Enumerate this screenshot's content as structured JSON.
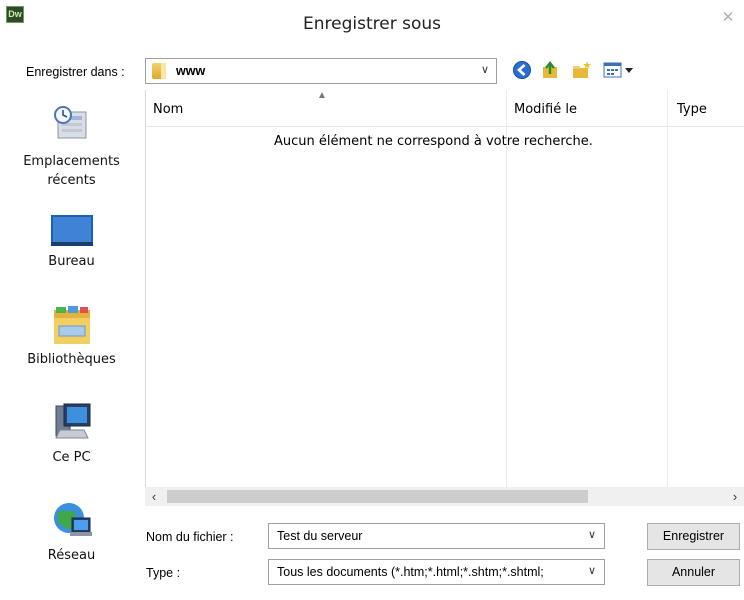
{
  "window": {
    "title": "Enregistrer sous",
    "app_icon": "Dw",
    "close_glyph": "✕"
  },
  "location": {
    "label": "Enregistrer dans :",
    "value": "www",
    "toolbar_icons": [
      "back-icon",
      "up-folder-icon",
      "new-folder-icon",
      "view-menu-icon"
    ]
  },
  "places": [
    {
      "label_line1": "Emplacements",
      "label_line2": "récents",
      "icon": "recent-places-icon"
    },
    {
      "label_line1": "Bureau",
      "icon": "desktop-icon"
    },
    {
      "label_line1": "Bibliothèques",
      "icon": "libraries-icon"
    },
    {
      "label_line1": "Ce PC",
      "icon": "computer-icon"
    },
    {
      "label_line1": "Réseau",
      "icon": "network-icon"
    }
  ],
  "filelist": {
    "columns": [
      "Nom",
      "Modifié le",
      "Type"
    ],
    "empty_message": "Aucun élément ne correspond à votre recherche."
  },
  "form": {
    "filename_label": "Nom du fichier :",
    "filename_value": "Test du serveur",
    "type_label": "Type :",
    "type_value": "Tous les documents (*.htm;*.html;*.shtm;*.shtml;"
  },
  "buttons": {
    "save": "Enregistrer",
    "cancel": "Annuler"
  }
}
